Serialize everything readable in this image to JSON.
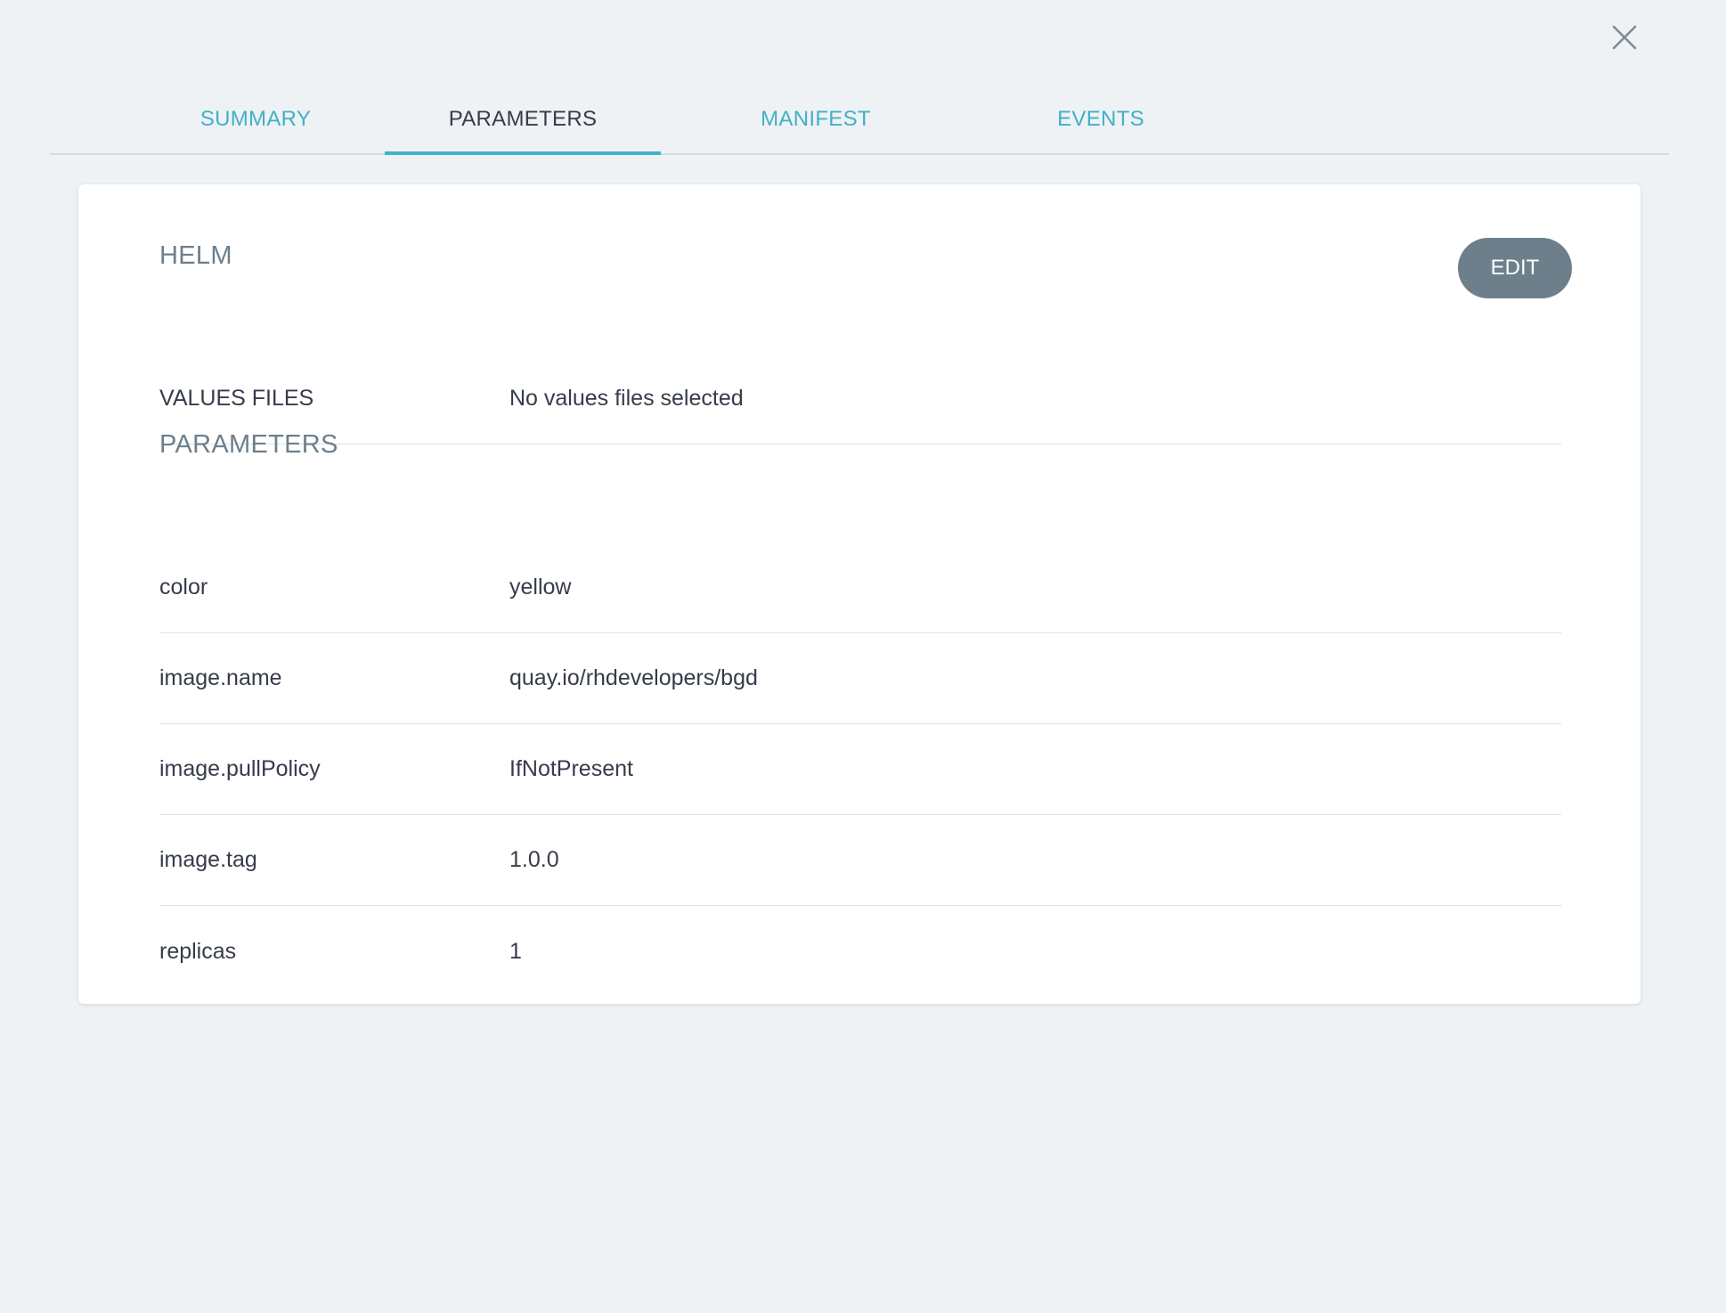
{
  "tabs": [
    {
      "label": "SUMMARY"
    },
    {
      "label": "PARAMETERS"
    },
    {
      "label": "MANIFEST"
    },
    {
      "label": "EVENTS"
    }
  ],
  "active_tab": "PARAMETERS",
  "helm": {
    "title": "HELM",
    "edit_label": "EDIT",
    "values_files_label": "VALUES FILES",
    "values_files_value": "No values files selected"
  },
  "parameters": {
    "title": "PARAMETERS",
    "rows": [
      {
        "key": "color",
        "value": "yellow"
      },
      {
        "key": "image.name",
        "value": "quay.io/rhdevelopers/bgd"
      },
      {
        "key": "image.pullPolicy",
        "value": "IfNotPresent"
      },
      {
        "key": "image.tag",
        "value": "1.0.0"
      },
      {
        "key": "replicas",
        "value": "1"
      }
    ]
  },
  "icons": {
    "close": "close-icon"
  },
  "colors": {
    "accent": "#42b0c8",
    "background": "#eef2f5",
    "button": "#6d7f8b",
    "text": "#363c4a"
  }
}
